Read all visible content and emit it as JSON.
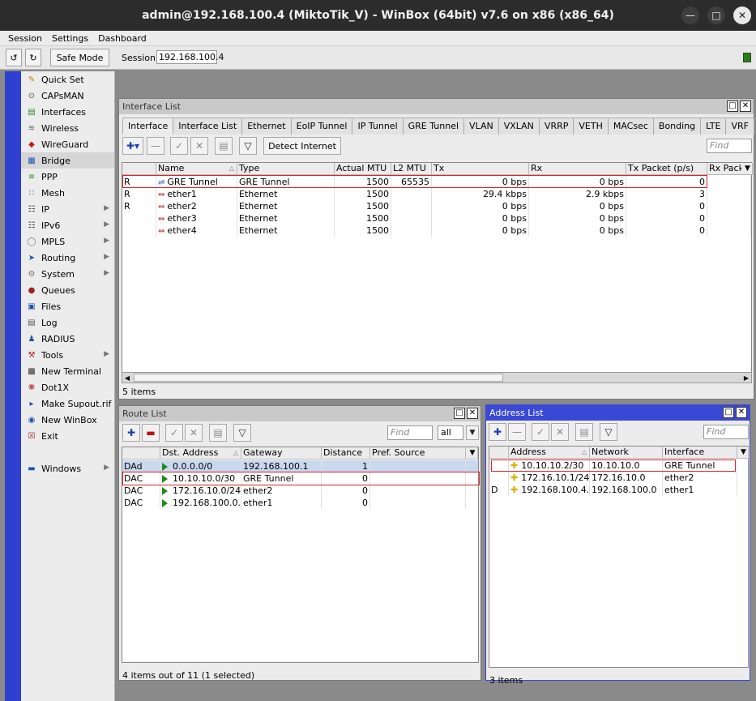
{
  "window": {
    "title": "admin@192.168.100.4 (MiktoTik_V) - WinBox (64bit) v7.6 on x86 (x86_64)"
  },
  "menu": [
    "Session",
    "Settings",
    "Dashboard"
  ],
  "toolbar": {
    "safe_mode": "Safe Mode",
    "session_label": "Session:",
    "session_value": "192.168.100.4"
  },
  "sidebar": [
    {
      "label": "Quick Set",
      "icon": "quick-set-icon",
      "arrow": false
    },
    {
      "label": "CAPsMAN",
      "icon": "capsman-icon",
      "arrow": false
    },
    {
      "label": "Interfaces",
      "icon": "interfaces-icon",
      "arrow": false
    },
    {
      "label": "Wireless",
      "icon": "wireless-icon",
      "arrow": false
    },
    {
      "label": "WireGuard",
      "icon": "wireguard-icon",
      "arrow": false
    },
    {
      "label": "Bridge",
      "icon": "bridge-icon",
      "arrow": false,
      "selected": true
    },
    {
      "label": "PPP",
      "icon": "ppp-icon",
      "arrow": false
    },
    {
      "label": "Mesh",
      "icon": "mesh-icon",
      "arrow": false
    },
    {
      "label": "IP",
      "icon": "ip-icon",
      "arrow": true
    },
    {
      "label": "IPv6",
      "icon": "ipv6-icon",
      "arrow": true
    },
    {
      "label": "MPLS",
      "icon": "mpls-icon",
      "arrow": true
    },
    {
      "label": "Routing",
      "icon": "routing-icon",
      "arrow": true
    },
    {
      "label": "System",
      "icon": "system-icon",
      "arrow": true
    },
    {
      "label": "Queues",
      "icon": "queues-icon",
      "arrow": false
    },
    {
      "label": "Files",
      "icon": "files-icon",
      "arrow": false
    },
    {
      "label": "Log",
      "icon": "log-icon",
      "arrow": false
    },
    {
      "label": "RADIUS",
      "icon": "radius-icon",
      "arrow": false
    },
    {
      "label": "Tools",
      "icon": "tools-icon",
      "arrow": true
    },
    {
      "label": "New Terminal",
      "icon": "terminal-icon",
      "arrow": false
    },
    {
      "label": "Dot1X",
      "icon": "dot1x-icon",
      "arrow": false
    },
    {
      "label": "Make Supout.rif",
      "icon": "supout-icon",
      "arrow": false
    },
    {
      "label": "New WinBox",
      "icon": "winbox-icon",
      "arrow": false
    },
    {
      "label": "Exit",
      "icon": "exit-icon",
      "arrow": false
    },
    {
      "label": "",
      "icon": "",
      "arrow": false,
      "spacer": true
    },
    {
      "label": "Windows",
      "icon": "windows-icon",
      "arrow": true
    }
  ],
  "interface_list": {
    "title": "Interface List",
    "tabs": [
      "Interface",
      "Interface List",
      "Ethernet",
      "EoIP Tunnel",
      "IP Tunnel",
      "GRE Tunnel",
      "VLAN",
      "VXLAN",
      "VRRP",
      "VETH",
      "MACsec",
      "Bonding",
      "LTE",
      "VRF"
    ],
    "detect_internet": "Detect Internet",
    "find_placeholder": "Find",
    "columns": [
      "Name",
      "Type",
      "Actual MTU",
      "L2 MTU",
      "Tx",
      "Rx",
      "Tx Packet (p/s)",
      "Rx Packe"
    ],
    "rows": [
      {
        "flag": "R",
        "name": "GRE Tunnel",
        "type": "GRE Tunnel",
        "mtu": "1500",
        "l2mtu": "65535",
        "tx": "0 bps",
        "rx": "0 bps",
        "txp": "0"
      },
      {
        "flag": "R",
        "name": "ether1",
        "type": "Ethernet",
        "mtu": "1500",
        "l2mtu": "",
        "tx": "29.4 kbps",
        "rx": "2.9 kbps",
        "txp": "3"
      },
      {
        "flag": "R",
        "name": "ether2",
        "type": "Ethernet",
        "mtu": "1500",
        "l2mtu": "",
        "tx": "0 bps",
        "rx": "0 bps",
        "txp": "0"
      },
      {
        "flag": "",
        "name": "ether3",
        "type": "Ethernet",
        "mtu": "1500",
        "l2mtu": "",
        "tx": "0 bps",
        "rx": "0 bps",
        "txp": "0"
      },
      {
        "flag": "",
        "name": "ether4",
        "type": "Ethernet",
        "mtu": "1500",
        "l2mtu": "",
        "tx": "0 bps",
        "rx": "0 bps",
        "txp": "0"
      }
    ],
    "status": "5 items"
  },
  "route_list": {
    "title": "Route List",
    "find_placeholder": "Find",
    "filter_value": "all",
    "columns": [
      "Dst. Address",
      "Gateway",
      "Distance",
      "Pref. Source"
    ],
    "rows": [
      {
        "flag": "DAd",
        "dst": "0.0.0.0/0",
        "gw": "192.168.100.1",
        "dist": "1"
      },
      {
        "flag": "DAC",
        "dst": "10.10.10.0/30",
        "gw": "GRE Tunnel",
        "dist": "0"
      },
      {
        "flag": "DAC",
        "dst": "172.16.10.0/24",
        "gw": "ether2",
        "dist": "0"
      },
      {
        "flag": "DAC",
        "dst": "192.168.100.0...",
        "gw": "ether1",
        "dist": "0"
      }
    ],
    "status": "4 items out of 11 (1 selected)"
  },
  "address_list": {
    "title": "Address List",
    "find_placeholder": "Find",
    "columns": [
      "Address",
      "Network",
      "Interface"
    ],
    "rows": [
      {
        "flag": "",
        "addr": "10.10.10.2/30",
        "net": "10.10.10.0",
        "iface": "GRE Tunnel"
      },
      {
        "flag": "",
        "addr": "172.16.10.1/24",
        "net": "172.16.10.0",
        "iface": "ether2"
      },
      {
        "flag": "D",
        "addr": "192.168.100.4...",
        "net": "192.168.100.0",
        "iface": "ether1"
      }
    ],
    "status": "3 items"
  }
}
